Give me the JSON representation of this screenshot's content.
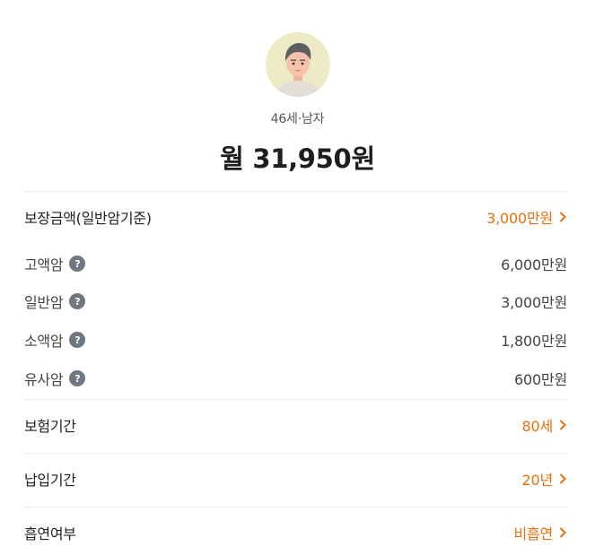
{
  "profile": {
    "avatar_icon": "male-avatar-icon",
    "subtitle": "46세·남자",
    "monthly_price": "월 31,950원"
  },
  "coverage": {
    "label": "보장금액(일반암기준)",
    "value": "3,000만원"
  },
  "cancer_items": [
    {
      "label": "고액암",
      "value": "6,000만원"
    },
    {
      "label": "일반암",
      "value": "3,000만원"
    },
    {
      "label": "소액암",
      "value": "1,800만원"
    },
    {
      "label": "유사암",
      "value": "600만원"
    }
  ],
  "help_icon_glyph": "?",
  "insurance_period": {
    "label": "보험기간",
    "value": "80세"
  },
  "payment_period": {
    "label": "납입기간",
    "value": "20년"
  },
  "smoking_status": {
    "label": "흡연여부",
    "value": "비흡연"
  },
  "colors": {
    "accent": "#e8700c",
    "help_icon_bg": "#6f7782",
    "avatar_bg": "#ecebc6"
  }
}
